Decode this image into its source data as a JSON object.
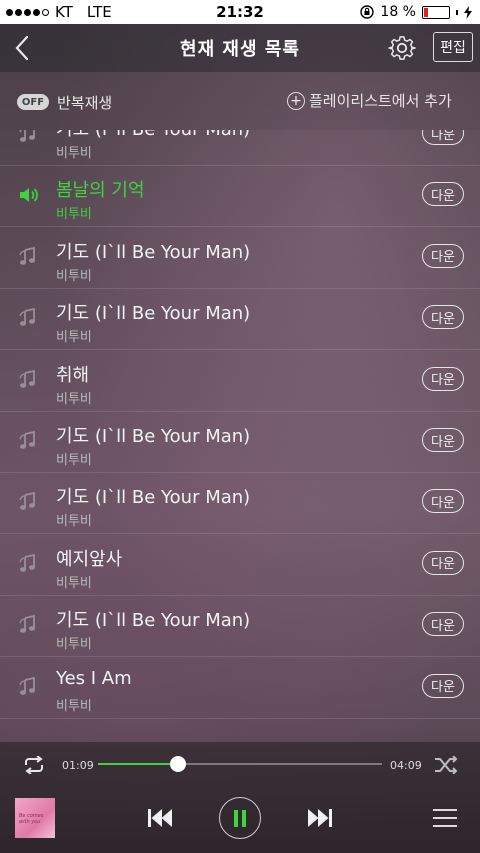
{
  "status_bar": {
    "carrier": "KT",
    "network": "LTE",
    "time": "21:32",
    "battery": "18 %",
    "battery_level": 0.18
  },
  "header": {
    "title": "현재 재생 목록",
    "edit_label": "편집",
    "icons": [
      "back-icon",
      "gear-icon"
    ]
  },
  "toolbar": {
    "repeat_toggle": "OFF",
    "repeat_label": "반복재생",
    "add_label": "플레이리스트에서 추가"
  },
  "songs": [
    {
      "title": "기도 (I`ll Be Your Man)",
      "artist": "비투비",
      "action": "다운",
      "active": false
    },
    {
      "title": "봄날의 기억",
      "artist": "비투비",
      "action": "다운",
      "active": true
    },
    {
      "title": "기도 (I`ll Be Your Man)",
      "artist": "비투비",
      "action": "다운",
      "active": false
    },
    {
      "title": "기도 (I`ll Be Your Man)",
      "artist": "비투비",
      "action": "다운",
      "active": false
    },
    {
      "title": "취해",
      "artist": "비투비",
      "action": "다운",
      "active": false
    },
    {
      "title": "기도 (I`ll Be Your Man)",
      "artist": "비투비",
      "action": "다운",
      "active": false
    },
    {
      "title": "기도 (I`ll Be Your Man)",
      "artist": "비투비",
      "action": "다운",
      "active": false
    },
    {
      "title": "예지앞사",
      "artist": "비투비",
      "action": "다운",
      "active": false
    },
    {
      "title": "기도 (I`ll Be Your Man)",
      "artist": "비투비",
      "action": "다운",
      "active": false
    },
    {
      "title": "Yes I Am",
      "artist": "비투비",
      "action": "다운",
      "active": false
    }
  ],
  "player": {
    "elapsed": "01:09",
    "total": "04:09",
    "progress": 0.28,
    "album_art_text": "Be comes with you",
    "accent_color": "#3dd43d",
    "icons": [
      "repeat-icon",
      "shuffle-icon",
      "previous-icon",
      "pause-icon",
      "next-icon",
      "menu-icon"
    ]
  }
}
